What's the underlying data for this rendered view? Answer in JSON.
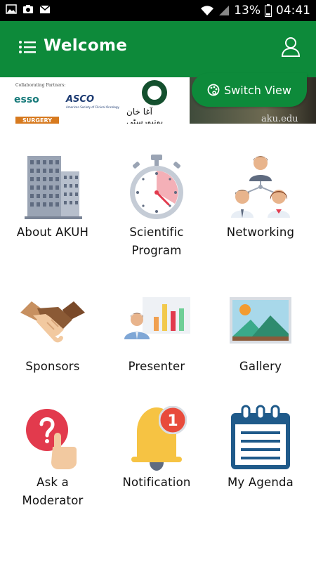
{
  "status_bar": {
    "battery": "13%",
    "time": "04:41"
  },
  "app_bar": {
    "title": "Welcome"
  },
  "banner": {
    "partners_label": "Collaborating Partners:",
    "logo_esso": "esso",
    "logo_asco": "ASCO",
    "logo_asco_sub": "American Society of Clinical Oncology",
    "logo_surgery": "SURGERY",
    "urdu_text": "آغا خان یونیورسٹی",
    "url_fragment": "aku.edu"
  },
  "switch_view": {
    "label": "Switch View"
  },
  "menu": [
    {
      "label": "About AKUH",
      "icon": "building-icon"
    },
    {
      "label": "Scientific\nProgram",
      "icon": "stopwatch-icon"
    },
    {
      "label": "Networking",
      "icon": "network-icon"
    },
    {
      "label": "Sponsors",
      "icon": "handshake-icon"
    },
    {
      "label": "Presenter",
      "icon": "presenter-icon"
    },
    {
      "label": "Gallery",
      "icon": "picture-icon"
    },
    {
      "label": "Ask a\nModerator",
      "icon": "question-hand-icon"
    },
    {
      "label": "Notification",
      "icon": "bell-icon",
      "badge": "1"
    },
    {
      "label": "My Agenda",
      "icon": "calendar-icon"
    }
  ]
}
